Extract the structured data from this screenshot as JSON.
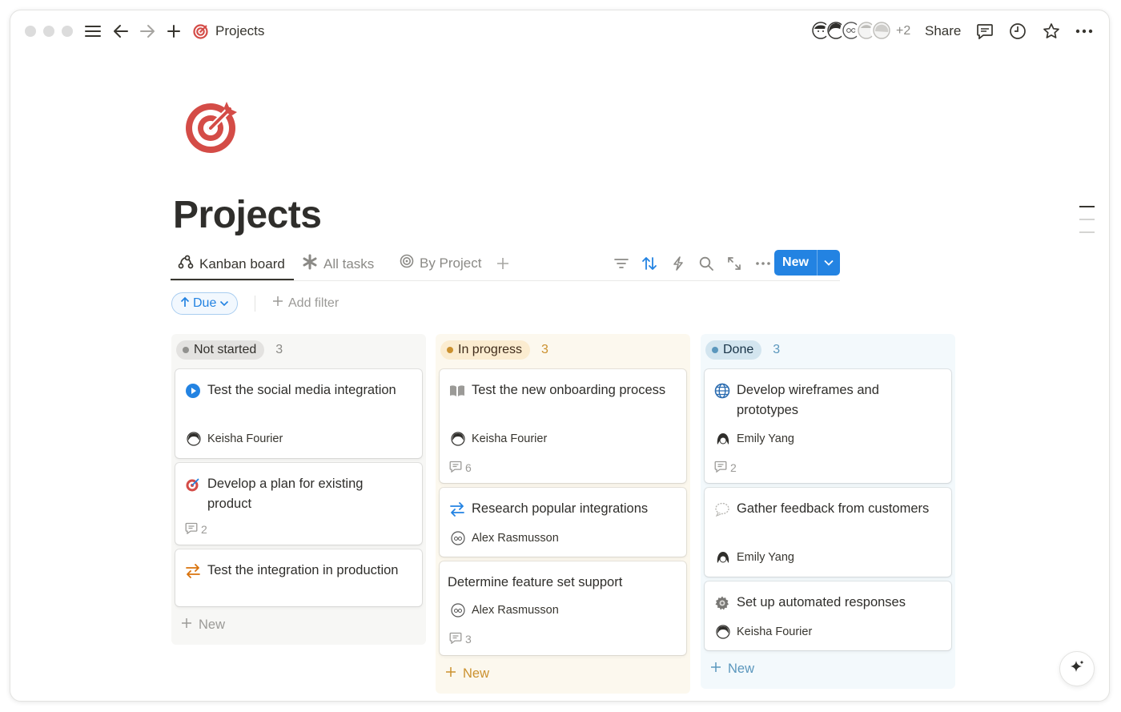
{
  "topbar": {
    "title": "Projects",
    "extra_members": "+2",
    "share_label": "Share"
  },
  "page": {
    "title": "Projects",
    "icon": "target-icon",
    "accent": "#d44c47"
  },
  "views": {
    "tabs": [
      {
        "label": "Kanban board",
        "icon": "kanban-icon",
        "active": true
      },
      {
        "label": "All tasks",
        "icon": "asterisk-icon",
        "active": false
      },
      {
        "label": "By Project",
        "icon": "target-outline-icon",
        "active": false
      }
    ],
    "new_label": "New"
  },
  "filters": {
    "sort_label": "Due",
    "add_filter_label": "Add filter"
  },
  "columns": [
    {
      "status": "Not started",
      "count": "3",
      "new_label": "New",
      "cards": [
        {
          "title": "Test the social media integration",
          "icon": "play-circle-icon",
          "assignee": "Keisha Fourier",
          "comments": ""
        },
        {
          "title": "Develop a plan for existing product",
          "icon": "dart-target-icon",
          "assignee": "",
          "comments": "2"
        },
        {
          "title": "Test the integration in production",
          "icon": "arrows-swap-icon",
          "assignee": "",
          "comments": ""
        }
      ]
    },
    {
      "status": "In progress",
      "count": "3",
      "new_label": "New",
      "cards": [
        {
          "title": "Test the new onboarding process",
          "icon": "book-icon",
          "assignee": "Keisha Fourier",
          "comments": "6"
        },
        {
          "title": "Research popular integrations",
          "icon": "arrows-swap-icon",
          "assignee": "Alex Rasmusson",
          "comments": ""
        },
        {
          "title": "Determine feature set support",
          "icon": "",
          "assignee": "Alex Rasmusson",
          "comments": "3"
        }
      ]
    },
    {
      "status": "Done",
      "count": "3",
      "new_label": "New",
      "cards": [
        {
          "title": "Develop wireframes and prototypes",
          "icon": "globe-icon",
          "assignee": "Emily Yang",
          "comments": "2"
        },
        {
          "title": "Gather feedback from customers",
          "icon": "speech-bubble-icon",
          "assignee": "Emily Yang",
          "comments": ""
        },
        {
          "title": "Set up automated responses",
          "icon": "gear-icon",
          "assignee": "Keisha Fourier",
          "comments": ""
        }
      ]
    }
  ]
}
